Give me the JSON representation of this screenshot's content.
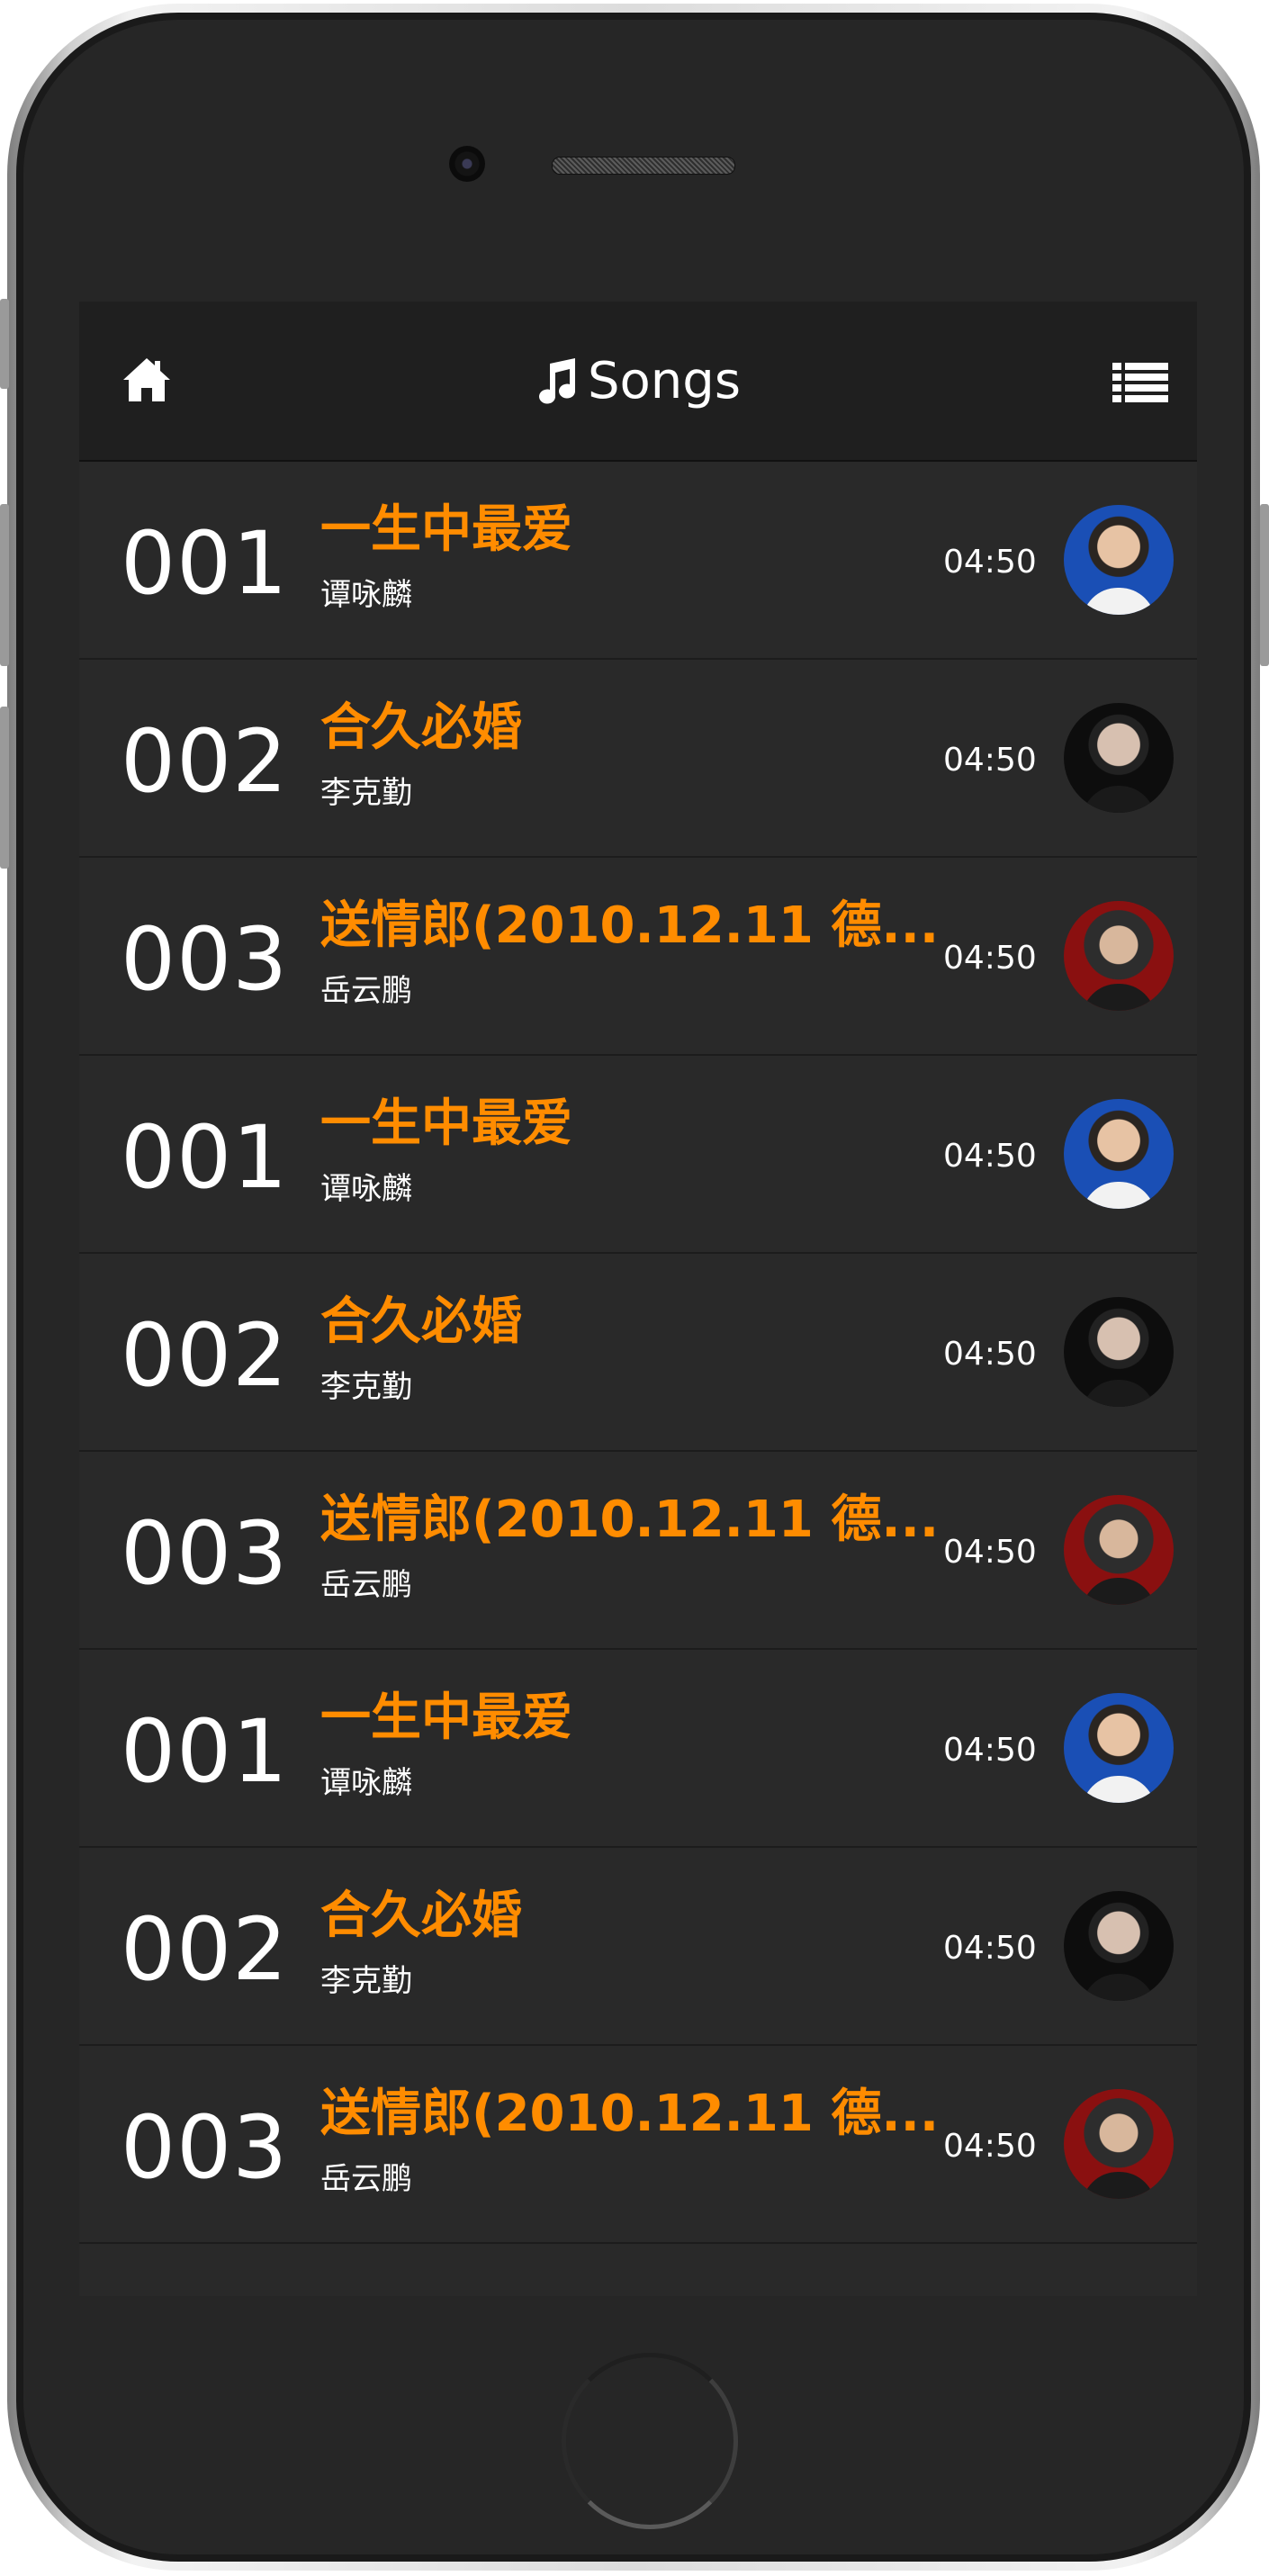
{
  "header": {
    "title": "Songs",
    "home_icon": "home-icon",
    "note_icon": "music-note-icon",
    "menu_icon": "list-icon"
  },
  "colors": {
    "title_accent": "#ff8c00",
    "screen_bg": "#292929",
    "topbar_bg": "#1f1f1f"
  },
  "songs": [
    {
      "num": "001",
      "title": "一生中最爱",
      "artist": "谭咏麟",
      "duration": "04:50",
      "avatar": "artist-avatar-blue"
    },
    {
      "num": "002",
      "title": "合久必婚",
      "artist": "李克勤",
      "duration": "04:50",
      "avatar": "artist-avatar-dark"
    },
    {
      "num": "003",
      "title": "送情郎(2010.12.11 德...",
      "artist": "岳云鹏",
      "duration": "04:50",
      "avatar": "artist-avatar-red"
    },
    {
      "num": "001",
      "title": "一生中最爱",
      "artist": "谭咏麟",
      "duration": "04:50",
      "avatar": "artist-avatar-blue"
    },
    {
      "num": "002",
      "title": "合久必婚",
      "artist": "李克勤",
      "duration": "04:50",
      "avatar": "artist-avatar-dark"
    },
    {
      "num": "003",
      "title": "送情郎(2010.12.11 德...",
      "artist": "岳云鹏",
      "duration": "04:50",
      "avatar": "artist-avatar-red"
    },
    {
      "num": "001",
      "title": "一生中最爱",
      "artist": "谭咏麟",
      "duration": "04:50",
      "avatar": "artist-avatar-blue"
    },
    {
      "num": "002",
      "title": "合久必婚",
      "artist": "李克勤",
      "duration": "04:50",
      "avatar": "artist-avatar-dark"
    },
    {
      "num": "003",
      "title": "送情郎(2010.12.11 德...",
      "artist": "岳云鹏",
      "duration": "04:50",
      "avatar": "artist-avatar-red"
    }
  ]
}
